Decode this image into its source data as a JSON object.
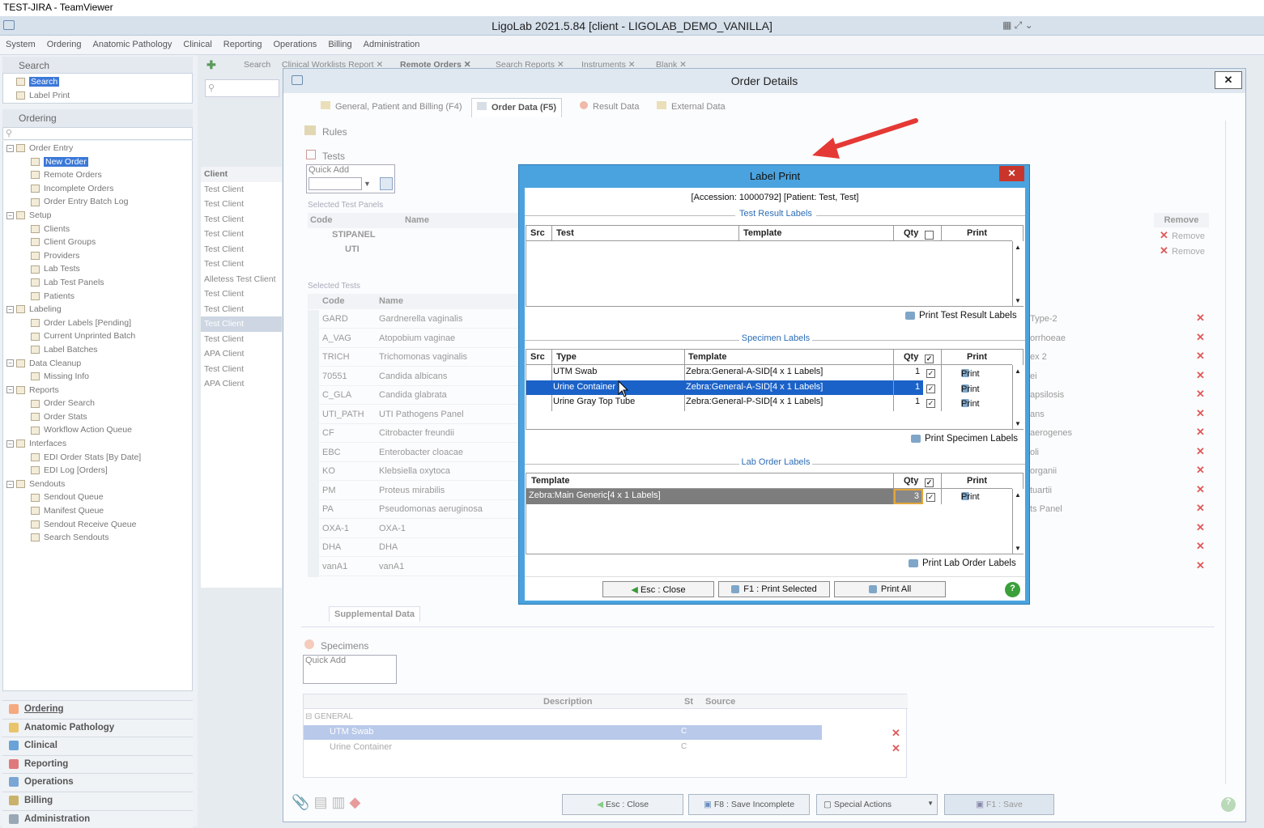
{
  "teamviewer_title": "TEST-JIRA - TeamViewer",
  "app_title": "LigoLab 2021.5.84 [client - LIGOLAB_DEMO_VANILLA]",
  "menu": [
    "System",
    "Ordering",
    "Anatomic Pathology",
    "Clinical",
    "Reporting",
    "Operations",
    "Billing",
    "Administration"
  ],
  "left": {
    "search_header": "Search",
    "search_items": [
      "Search",
      "Label Print"
    ],
    "ordering_header": "Ordering",
    "tree": [
      "Order Entry",
      "New Order",
      "Remote Orders",
      "Incomplete Orders",
      "Order Entry Batch Log",
      "Setup",
      "Clients",
      "Client Groups",
      "Providers",
      "Lab Tests",
      "Lab Test Panels",
      "Patients",
      "Labeling",
      "Order Labels [Pending]",
      "Current Unprinted Batch",
      "Label Batches",
      "Data Cleanup",
      "Missing Info",
      "Reports",
      "Order Search",
      "Order Stats",
      "Workflow Action Queue",
      "Interfaces",
      "EDI Order Stats [By Date]",
      "EDI Log [Orders]",
      "Sendouts",
      "Sendout Queue",
      "Manifest Queue",
      "Sendout Receive Queue",
      "Search Sendouts"
    ],
    "nav": [
      "Ordering",
      "Anatomic Pathology",
      "Clinical",
      "Reporting",
      "Operations",
      "Billing",
      "Administration"
    ]
  },
  "tabs": [
    "Search",
    "Clinical Worklists Report",
    "Remote Orders",
    "Search Reports",
    "Instruments",
    "Blank"
  ],
  "client_table": {
    "header": "Client",
    "rows": [
      "Test Client",
      "Test Client",
      "Test Client",
      "Test Client",
      "Test Client",
      "Test Client",
      "Alletess Test Client",
      "Test Client",
      "Test Client",
      "Test Client",
      "Test Client",
      "APA Client",
      "Test Client",
      "APA Client"
    ]
  },
  "order_details": {
    "title": "Order Details",
    "tabs": [
      "General, Patient and Billing (F4)",
      "Order Data (F5)",
      "Result Data",
      "External Data"
    ],
    "rules": "Rules",
    "tests": "Tests",
    "quick_add": "Quick Add",
    "selected_panels": "Selected Test Panels",
    "code": "Code",
    "name": "Name",
    "panels": [
      "STIPANEL",
      "UTI"
    ],
    "remove": "Remove",
    "selected_tests": "Selected Tests",
    "tests_list": [
      [
        "GARD",
        "Gardnerella vaginalis"
      ],
      [
        "A_VAG",
        "Atopobium vaginae"
      ],
      [
        "TRICH",
        "Trichomonas vaginalis"
      ],
      [
        "70551",
        "Candida albicans"
      ],
      [
        "C_GLA",
        "Candida glabrata"
      ],
      [
        "UTI_PATH",
        "UTI Pathogens Panel"
      ],
      [
        "CF",
        "Citrobacter freundii"
      ],
      [
        "EBC",
        "Enterobacter cloacae"
      ],
      [
        "KO",
        "Klebsiella oxytoca"
      ],
      [
        "PM",
        "Proteus mirabilis"
      ],
      [
        "PA",
        "Pseudomonas aeruginosa"
      ],
      [
        "OXA-1",
        "OXA-1"
      ],
      [
        "DHA",
        "DHA"
      ],
      [
        "vanA1",
        "vanA1"
      ]
    ],
    "right_fragments": [
      "Type-2",
      "orrhoeae",
      "ex 2",
      "ei",
      "apsilosis",
      "ans",
      "aerogenes",
      "oli",
      "organii",
      "tuartii",
      "ts Panel"
    ],
    "supplemental": "Supplemental Data",
    "specimens": "Specimens",
    "spec_headers": [
      "Description",
      "St",
      "Source"
    ],
    "spec_group": "GENERAL",
    "spec_rows": [
      [
        "UTM Swab",
        "C"
      ],
      [
        "Urine Container",
        "C"
      ]
    ],
    "buttons": [
      "Esc : Close",
      "F8 : Save Incomplete",
      "Special Actions",
      "F1 : Save"
    ]
  },
  "label_print": {
    "title": "Label Print",
    "accession": "[Accession: 10000792] [Patient: Test, Test]",
    "test_result_labels": "Test Result Labels",
    "tr_headers": [
      "Src",
      "Test",
      "Template",
      "Qty",
      "Print"
    ],
    "print_test_result": "Print Test Result Labels",
    "specimen_labels": "Specimen Labels",
    "sp_headers": [
      "Src",
      "Type",
      "Template",
      "Qty",
      "Print"
    ],
    "specimens": [
      {
        "type": "UTM Swab",
        "template": "Zebra:General-A-SID[4 x 1 Labels]",
        "qty": "1",
        "print": "Print"
      },
      {
        "type": "Urine Container",
        "template": "Zebra:General-A-SID[4 x 1 Labels]",
        "qty": "1",
        "print": "Print"
      },
      {
        "type": "Urine Gray Top Tube",
        "template": "Zebra:General-P-SID[4 x 1 Labels]",
        "qty": "1",
        "print": "Print"
      }
    ],
    "print_specimen": "Print Specimen Labels",
    "lab_order_labels": "Lab Order Labels",
    "lo_headers": [
      "Template",
      "Qty",
      "Print"
    ],
    "lab_order": {
      "template": "Zebra:Main Generic[4 x 1 Labels]",
      "qty": "3",
      "print": "Print"
    },
    "print_lab_order": "Print Lab Order Labels",
    "btn_close": "Esc : Close",
    "btn_print_selected": "F1 : Print Selected",
    "btn_print_all": "Print All"
  },
  "colors": {
    "accent": "#3b78d8",
    "dialog_border": "#4aa3df",
    "arrow": "#e53935",
    "remove": "#e05a5a"
  }
}
